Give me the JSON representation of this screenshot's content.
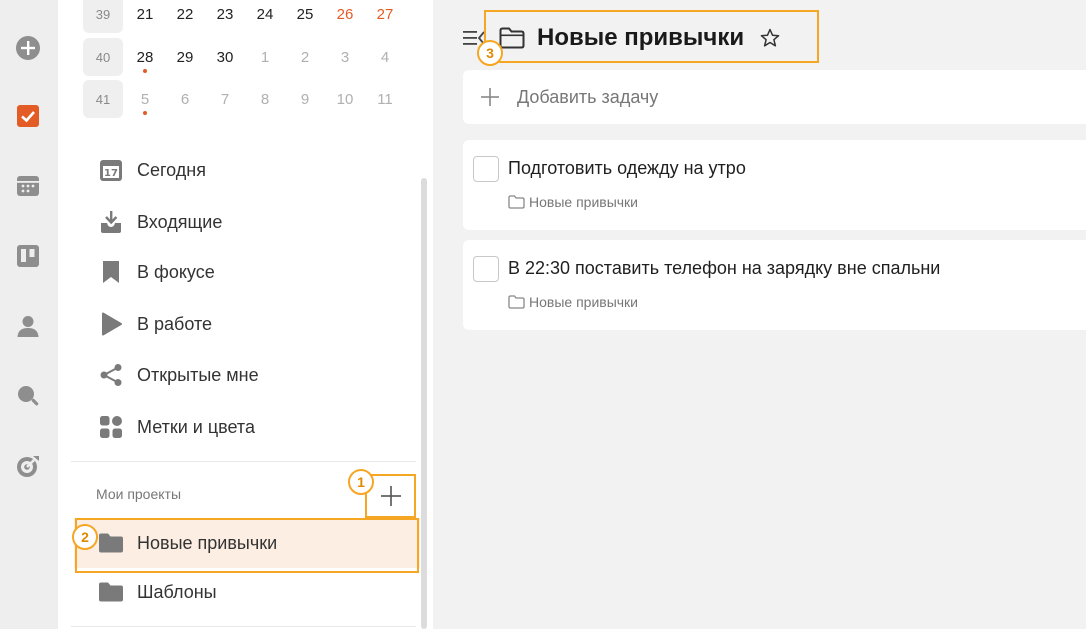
{
  "calendar": {
    "rows": [
      {
        "week": "39",
        "days": [
          {
            "n": "21",
            "muted": false,
            "weekend": false,
            "dot": false
          },
          {
            "n": "22",
            "muted": false,
            "weekend": false,
            "dot": false
          },
          {
            "n": "23",
            "muted": false,
            "weekend": false,
            "dot": false
          },
          {
            "n": "24",
            "muted": false,
            "weekend": false,
            "dot": false
          },
          {
            "n": "25",
            "muted": false,
            "weekend": false,
            "dot": false
          },
          {
            "n": "26",
            "muted": false,
            "weekend": true,
            "dot": false
          },
          {
            "n": "27",
            "muted": false,
            "weekend": true,
            "dot": false
          }
        ]
      },
      {
        "week": "40",
        "days": [
          {
            "n": "28",
            "muted": false,
            "weekend": false,
            "dot": true
          },
          {
            "n": "29",
            "muted": false,
            "weekend": false,
            "dot": false
          },
          {
            "n": "30",
            "muted": false,
            "weekend": false,
            "dot": false
          },
          {
            "n": "1",
            "muted": true,
            "weekend": false,
            "dot": false
          },
          {
            "n": "2",
            "muted": true,
            "weekend": false,
            "dot": false
          },
          {
            "n": "3",
            "muted": true,
            "weekend": false,
            "dot": false
          },
          {
            "n": "4",
            "muted": true,
            "weekend": false,
            "dot": false
          }
        ]
      },
      {
        "week": "41",
        "days": [
          {
            "n": "5",
            "muted": true,
            "weekend": false,
            "dot": true
          },
          {
            "n": "6",
            "muted": true,
            "weekend": false,
            "dot": false
          },
          {
            "n": "7",
            "muted": true,
            "weekend": false,
            "dot": false
          },
          {
            "n": "8",
            "muted": true,
            "weekend": false,
            "dot": false
          },
          {
            "n": "9",
            "muted": true,
            "weekend": false,
            "dot": false
          },
          {
            "n": "10",
            "muted": true,
            "weekend": false,
            "dot": false
          },
          {
            "n": "11",
            "muted": true,
            "weekend": false,
            "dot": false
          }
        ]
      }
    ]
  },
  "nav": {
    "today_badge": "17",
    "items": [
      {
        "label": "Сегодня",
        "icon": "calendar-today-icon"
      },
      {
        "label": "Входящие",
        "icon": "inbox-icon"
      },
      {
        "label": "В фокусе",
        "icon": "bookmark-icon"
      },
      {
        "label": "В работе",
        "icon": "play-icon"
      },
      {
        "label": "Открытые мне",
        "icon": "share-icon"
      },
      {
        "label": "Метки и цвета",
        "icon": "tags-grid-icon"
      }
    ]
  },
  "projects": {
    "section_label": "Мои проекты",
    "items": [
      {
        "label": "Новые привычки",
        "active": true
      },
      {
        "label": "Шаблоны",
        "active": false
      }
    ]
  },
  "annotations": {
    "b1": "1",
    "b2": "2",
    "b3": "3"
  },
  "header": {
    "title": "Новые привычки"
  },
  "add_task": {
    "label": "Добавить задачу"
  },
  "tasks": [
    {
      "title": "Подготовить одежду на утро",
      "project": "Новые привычки"
    },
    {
      "title": "В 22:30 поставить телефон на зарядку вне спальни",
      "project": "Новые привычки"
    }
  ],
  "colors": {
    "accent": "#e35b25",
    "highlight": "#f5a623",
    "active_bg": "#fdeee4"
  }
}
